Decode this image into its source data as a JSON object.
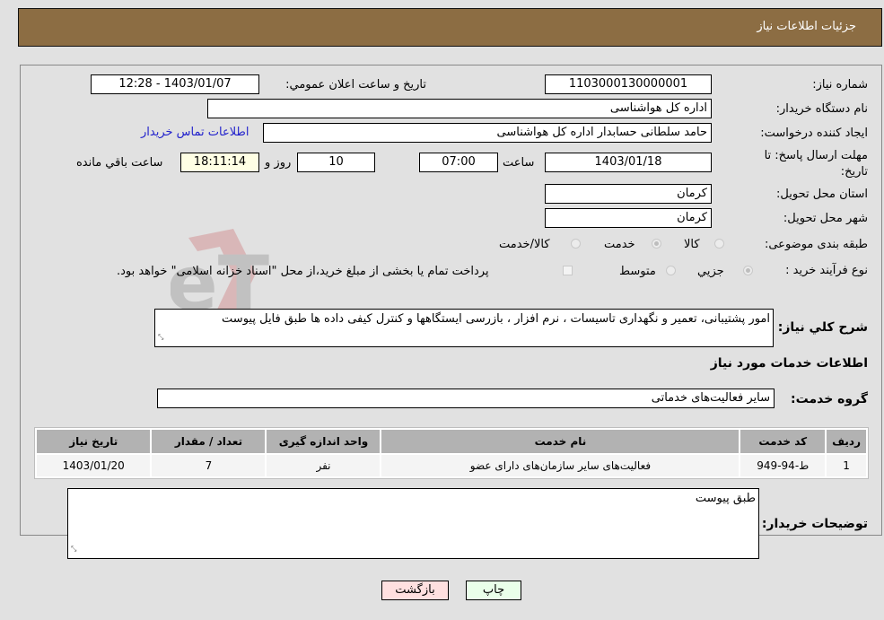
{
  "header": {
    "title": "جزئیات اطلاعات نیاز"
  },
  "fields": {
    "need_number": {
      "label": "شماره نیاز:",
      "value": "1103000130000001"
    },
    "announce": {
      "label": "تاریخ و ساعت اعلان عمومي:",
      "value": "1403/01/07 - 12:28"
    },
    "buyer_org": {
      "label": "نام دستگاه خریدار:",
      "value": "اداره کل هواشناسی"
    },
    "creator": {
      "label": "ایجاد کننده درخواست:",
      "value": "حامد سلطانی  حسابدار اداره کل هواشناسی"
    },
    "contact_link": "اطلاعات تماس خریدار",
    "deadline": {
      "label": "مهلت ارسال پاسخ: تا تاریخ:",
      "date": "1403/01/18",
      "time_label": "ساعت",
      "time": "07:00",
      "days": "10",
      "days_label": "روز و",
      "remaining": "18:11:14",
      "remaining_label": "ساعت باقي مانده"
    },
    "province": {
      "label": "استان محل تحویل:",
      "value": "کرمان"
    },
    "city": {
      "label": "شهر محل تحویل:",
      "value": "کرمان"
    },
    "category": {
      "label": "طبقه بندی موضوعی:",
      "options": [
        "کالا",
        "خدمت",
        "کالا/خدمت"
      ],
      "selected": "خدمت"
    },
    "process": {
      "label": "نوع فرآیند خرید :",
      "options": [
        "جزیي",
        "متوسط"
      ],
      "selected": "جزیي",
      "payment_note": "پرداخت تمام یا بخشی از مبلغ خرید،از محل \"اسناد خزانه اسلامی\" خواهد بود."
    }
  },
  "description": {
    "label": "شرح کلي نیاز:",
    "value": "امور پشتیبانی، تعمیر و نگهداری تاسیسات ، نرم افزار ، بازرسی ایستگاهها و کنترل کیفی داده ها طبق فایل پیوست"
  },
  "services_section": {
    "title": "اطلاعات خدمات مورد نیاز",
    "group_label": "گروه خدمت:",
    "group_value": "سایر فعالیت‌های خدماتی"
  },
  "table": {
    "headers": [
      "ردیف",
      "کد خدمت",
      "نام خدمت",
      "واحد اندازه گیری",
      "تعداد / مقدار",
      "تاریخ نیاز"
    ],
    "rows": [
      [
        "1",
        "ط-94-949",
        "فعالیت‌های سایر سازمان‌های دارای عضو",
        "نفر",
        "7",
        "1403/01/20"
      ]
    ]
  },
  "buyer_notes": {
    "label": "توضیحات خریدار:",
    "value": "طبق پیوست"
  },
  "buttons": {
    "print": "چاپ",
    "back": "بازگشت"
  },
  "colors": {
    "header_bg": "#8c6d43",
    "print_bg": "#eaffea",
    "back_bg": "#ffe0e0",
    "link": "#2222cc"
  },
  "watermark": "AriaTender.neT"
}
